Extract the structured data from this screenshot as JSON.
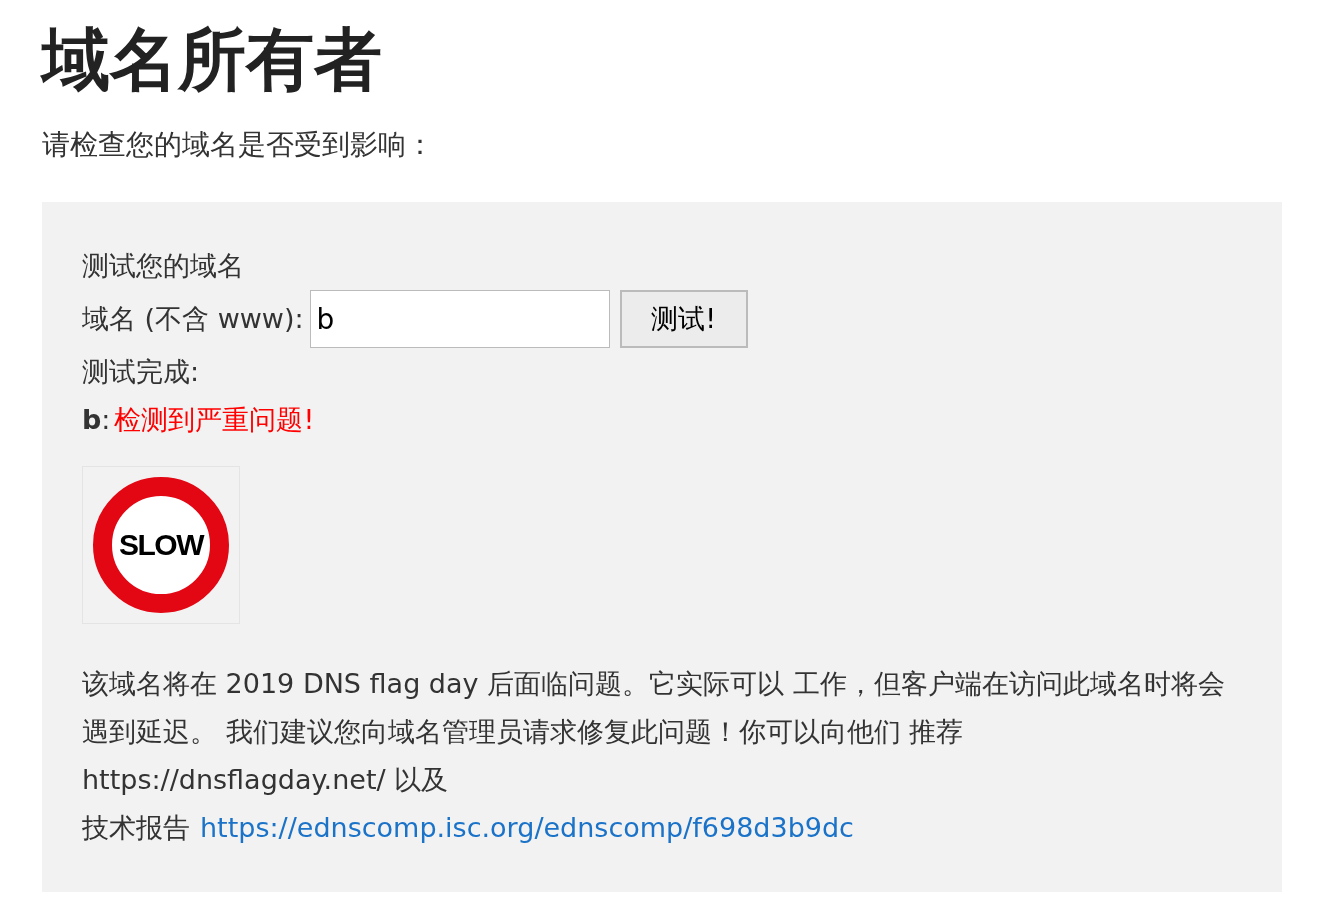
{
  "heading": "域名所有者",
  "intro": "请检查您的域名是否受到影响：",
  "panel": {
    "title": "测试您的域名",
    "field_label": "域名 (不含 www):",
    "field_value": "b",
    "button": "测试!",
    "status": "测试完成:",
    "result_domain": "b",
    "result_separator": ":",
    "result_message": "检测到严重问题!",
    "sign": {
      "kind": "slow",
      "text": "SLOW"
    },
    "description": "该域名将在 2019 DNS flag day 后面临问题。它实际可以 工作，但客户端在访问此域名时将会遇到延迟。 我们建议您向域名管理员请求修复此问题！你可以向他们 推荐 https://dnsflagday.net/ 以及",
    "report_label": "技术报告",
    "report_link": "https://ednscomp.isc.org/ednscomp/f698d3b9dc"
  }
}
